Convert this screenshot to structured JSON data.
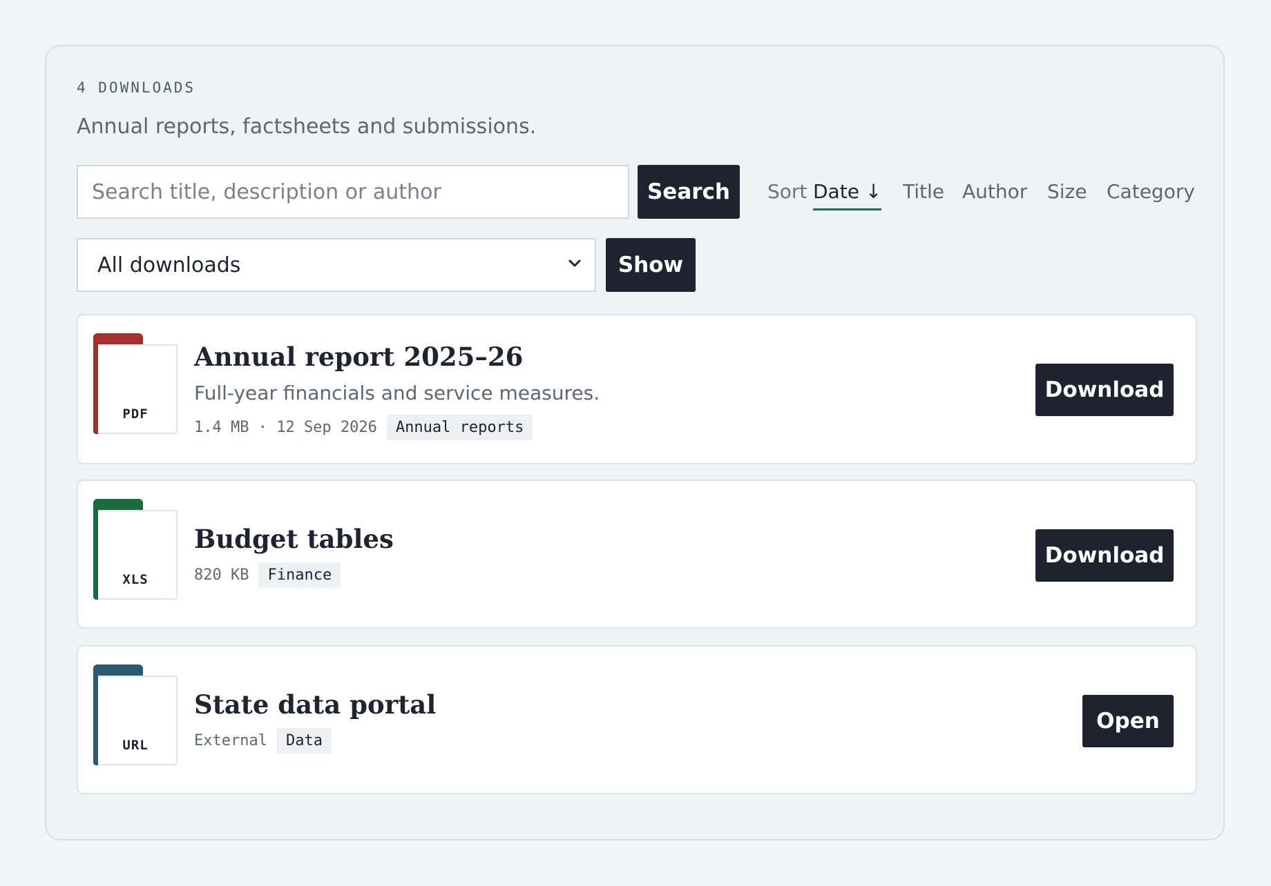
{
  "downloads": {
    "count_label": "4 DOWNLOADS",
    "subtitle": "Annual reports, factsheets and submissions."
  },
  "search": {
    "placeholder": "Search title, description or author",
    "button_label": "Search"
  },
  "sort": {
    "label": "Sort",
    "options": [
      "Date ↓",
      "Title",
      "Author",
      "Size",
      "Category"
    ],
    "active": "Date ↓"
  },
  "filter": {
    "selected": "All downloads",
    "button_label": "Show"
  },
  "items": [
    {
      "type": "PDF",
      "type_color": "#a2302f",
      "title": "Annual report 2025–26",
      "description": "Full-year financials and service measures.",
      "meta": "1.4 MB · 12 Sep 2026",
      "category": "Annual reports",
      "action": "Download"
    },
    {
      "type": "XLS",
      "type_color": "#1d6a40",
      "title": "Budget tables",
      "meta": "820 KB",
      "category": "Finance",
      "action": "Download"
    },
    {
      "type": "URL",
      "type_color": "#2a5870",
      "title": "State data portal",
      "meta": "External",
      "category": "Data",
      "action": "Open"
    }
  ],
  "icons": {
    "select_chevron": "chevron-down-icon"
  }
}
